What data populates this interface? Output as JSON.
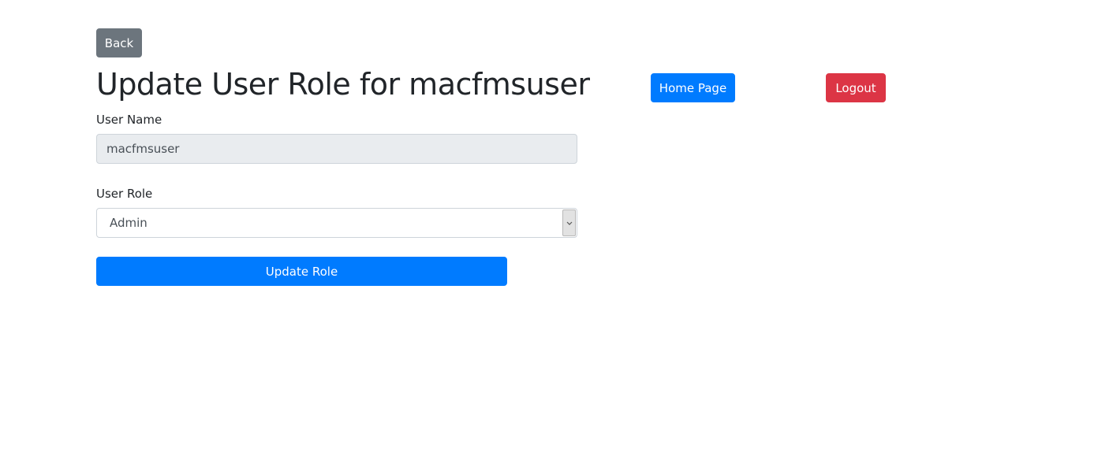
{
  "nav": {
    "back_label": "Back",
    "home_label": "Home Page",
    "logout_label": "Logout"
  },
  "page": {
    "title": "Update User Role for macfmsuser"
  },
  "form": {
    "username_label": "User Name",
    "username_value": "macfmsuser",
    "role_label": "User Role",
    "role_selected": "Admin",
    "submit_label": "Update Role"
  },
  "colors": {
    "primary": "#007bff",
    "secondary": "#6c757d",
    "danger": "#dc3545",
    "readonly_bg": "#e9ecef"
  },
  "icons": {
    "select_arrow": "chevron-down-icon"
  }
}
